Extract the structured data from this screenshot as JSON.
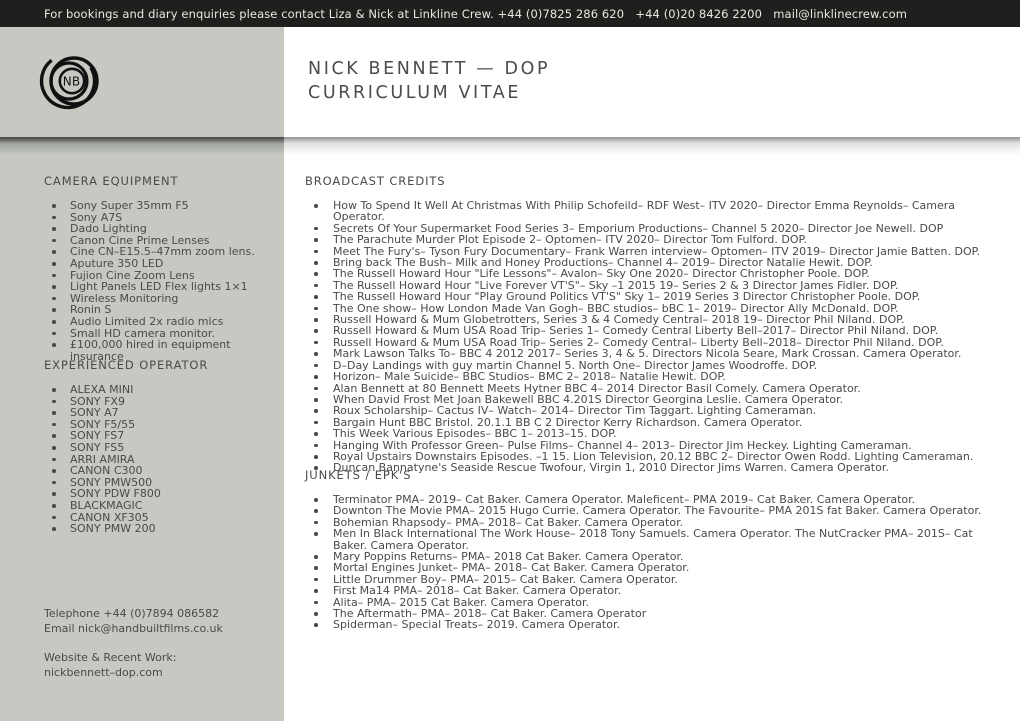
{
  "topbar": {
    "text": "For bookings and diary enquiries please contact Liza & Nick at Linkline Crew. +44 (0)7825 286 620   +44 (0)20 8426 2200   mail@linklinecrew.com"
  },
  "header": {
    "title": "NICK BENNETT — DOP\nCURRICULUM VITAE",
    "logo_initials": "NB"
  },
  "colors": {
    "topbar_bg": "#201f1d",
    "sidebar_bg": "#c5c9c2",
    "page_bg": "#ffffff",
    "text": "#4a4a4a"
  },
  "sidebar": {
    "camera_equipment": {
      "heading": "CAMERA EQUIPMENT",
      "items": [
        "Sony Super 35mm F5",
        "Sony A7S",
        "Dado Lighting",
        "Canon Cine Prime Lenses",
        "Cine CN–E15.5–47mm zoom lens.",
        "Aputure 350 LED",
        "Fujion Cine Zoom Lens",
        "Light Panels LED Flex lights 1×1",
        "Wireless Monitoring",
        "Ronin S",
        "Audio Limited 2x radio mics",
        "Small HD camera monitor.",
        "£100,000 hired in equipment insurance"
      ]
    },
    "experienced_operator": {
      "heading": "EXPERIENCED OPERATOR",
      "items": [
        "ALEXA MINI",
        "SONY FX9",
        "SONY A7",
        "SONY F5/55",
        "SONY FS7",
        "SONY FS5",
        "ARRI AMIRA",
        "CANON C300",
        "SONY PMW500",
        "SONY PDW F800",
        "BLACKMAGIC",
        "CANON XF305",
        "SONY PMW 200"
      ]
    },
    "contact": {
      "telephone": "Telephone +44 (0)7894 086582",
      "email": "Email nick@handbuiltfilms.co.uk",
      "website_label": "Website & Recent Work:",
      "website": "nickbennett–dop.com"
    }
  },
  "main": {
    "broadcast_credits": {
      "heading": "BROADCAST CREDITS",
      "items": [
        "How To Spend It Well At Christmas With Philip Schofeild– RDF West– ITV 2020– Director Emma Reynolds– Camera Operator.",
        "Secrets Of Your Supermarket Food Series 3– Emporium Productions– Channel 5 2020– Director Joe Newell. DOP",
        "The Parachute Murder Plot Episode 2– Optomen– ITV 2020– Director Tom Fulford. DOP.",
        "Meet The Fury's– Tyson Fury Documentary– Frank Warren interview– Optomen– ITV 2019– Director Jamie Batten. DOP.",
        "Bring back The Bush– Milk and Honey Productions– Channel 4– 2019– Director Natalie Hewit. DOP.",
        "The Russell Howard Hour \"Life Lessons\"– Avalon– Sky One 2020– Director Christopher Poole. DOP.",
        "The Russell Howard Hour \"Live Forever VT'S\"– Sky –1 2015 19– Series 2 & 3 Director James Fidler. DOP.",
        "The Russell Howard Hour \"Play Ground Politics VT'S\" Sky 1– 2019 Series 3  Director Christopher Poole. DOP.",
        "The One show– How London Made Van Gogh– BBC studios–  bBC 1– 2019– Director Ally McDonald. DOP.",
        "Russell Howard & Mum Globetrotters, Series 3 & 4 Comedy Central– 2018 19– Director Phil Niland. DOP.",
        "Russell Howard & Mum USA Road Trip– Series 1– Comedy Central Liberty Bell–2017– Director  Phil Niland. DOP.",
        "Russell Howard & Mum USA Road Trip– Series 2– Comedy Central– Liberty Bell–2018– Director Phil Niland. DOP.",
        "Mark Lawson Talks To– BBC 4 2012 2017– Series 3, 4 & 5. Directors Nicola Seare, Mark Crossan. Camera Operator.",
        "D–Day Landings with guy martin Channel 5. North One– Director James Woodroffe. DOP.",
        "Horizon– Male Suicide– BBC Studios– BMC 2– 2018– Natalie Hewit. DOP.",
        "Alan Bennett at 80 Bennett Meets Hytner BBC 4– 2014 Director Basil Comely. Camera Operator.",
        "When David Frost Met Joan Bakewell BBC 4.201S Director Georgina Leslie. Camera Operator.",
        "Roux Scholarship– Cactus IV– Watch– 2014– Director Tim Taggart. Lighting Cameraman.",
        "Bargain Hunt BBC Bristol. 20.1.1 BB C 2 Director Kerry Richardson. Camera Operator.",
        "This Week Various Episodes– BBC 1– 2013–15. DOP.",
        "Hanging With Professor Green– Pulse Films– Channel 4– 2013– Director Jim Heckey. Lighting Cameraman.",
        "Royal Upstairs Downstairs Episodes. –1 15. Lion Television, 20.12 BBC 2– Director Owen Rodd. Lighting Cameraman.",
        "Duncan Bannatyne's Seaside Rescue Twofour, Virgin 1, 2010 Director Jims Warren. Camera Operator."
      ]
    },
    "junkets": {
      "heading": "JUNKETS / EPK'S",
      "items": [
        "Terminator PMA– 2019– Cat Baker. Camera Operator. Maleficent– PMA 2019– Cat Baker. Camera Operator.",
        "Downton The Movie PMA– 2015 Hugo Currie. Camera Operator. The Favourite– PMA 201S fat Baker. Camera Operator.",
        "Bohemian Rhapsody– PMA– 2018– Cat Baker. Camera Operator.",
        "Men In Black International The Work House– 2018 Tony Samuels. Camera  Operator. The NutCracker PMA– 201S– Cat Baker. Camera Operator.",
        "Mary Poppins Returns– PMA– 2018 Cat Baker. Camera Operator.",
        "Mortal Engines Junket– PMA– 2018– Cat Baker. Camera Operator.",
        "Little Drummer Boy– PMA– 2015– Cat Baker.  Camera Operator.",
        "First Ma14 PMA– 2018– Cat Baker. Camera Operator.",
        "Alita– PMA– 2015 Cat Baker. Camera Operator.",
        "The Aftermath– PMA– 2018– Cat Baker. Camera Operator",
        "Spiderman– Special Treats– 2019. Camera Operator."
      ]
    }
  }
}
